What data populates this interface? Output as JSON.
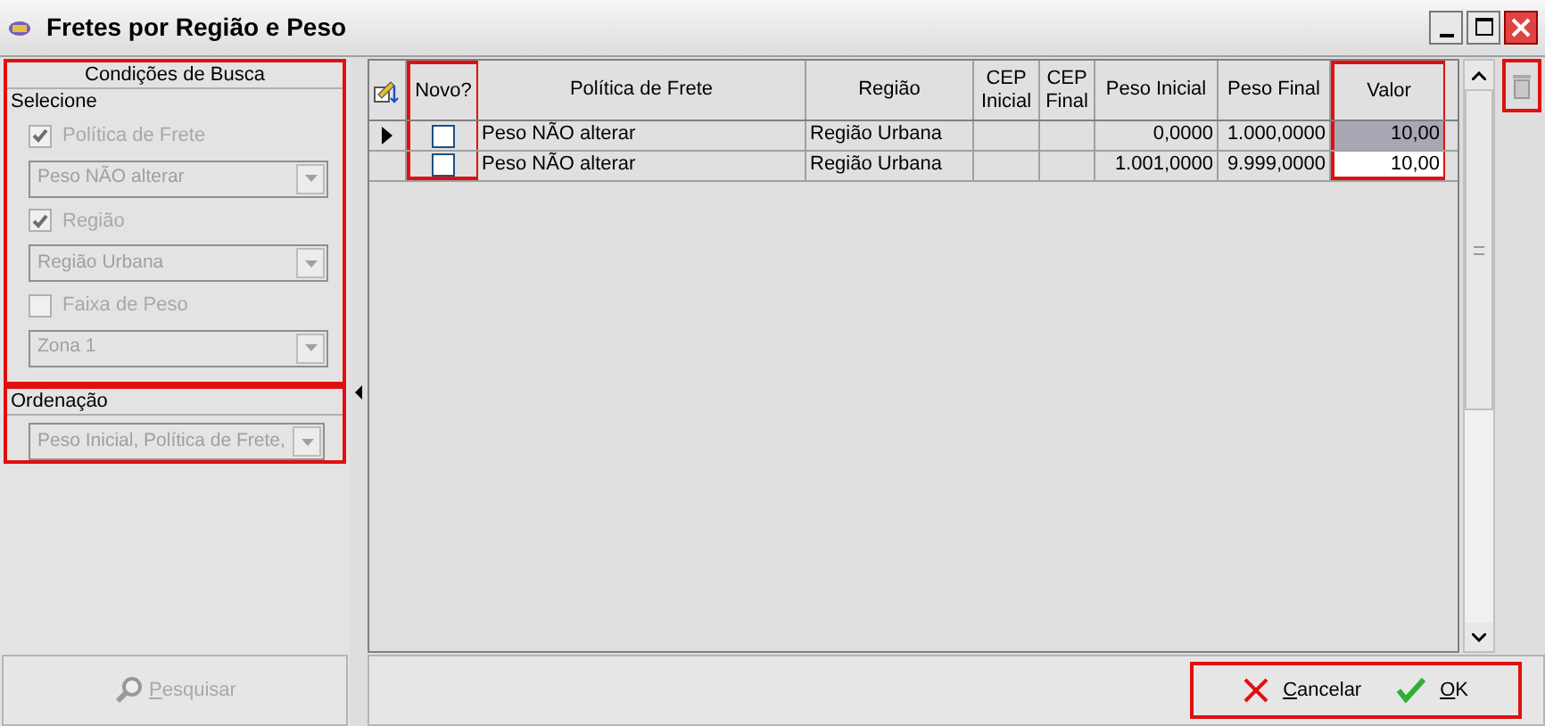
{
  "window": {
    "title": "Fretes por Região e Peso"
  },
  "search_panel": {
    "title": "Condições de Busca",
    "group_label": "Selecione",
    "filters": [
      {
        "label": "Política de Frete",
        "checked": true,
        "disabled": true,
        "value": "Peso NÃO alterar"
      },
      {
        "label": "Região",
        "checked": true,
        "disabled": true,
        "value": "Região Urbana"
      },
      {
        "label": "Faixa de Peso",
        "checked": false,
        "disabled": true,
        "value": "Zona 1"
      }
    ],
    "ordering": {
      "label": "Ordenação",
      "value": "Peso Inicial, Política de Frete,",
      "disabled": true
    },
    "search_button": {
      "label": "Pesquisar",
      "disabled": true
    }
  },
  "table": {
    "checkbox_column": "Novo?",
    "columns": [
      "Política de Frete",
      "Região",
      "CEP Inicial",
      "CEP Final",
      "Peso Inicial",
      "Peso Final",
      "Valor"
    ],
    "rows": [
      {
        "selected": true,
        "novo": false,
        "cells": [
          "Peso NÃO alterar",
          "Região Urbana",
          "",
          "",
          "0,0000",
          "1.000,0000",
          "10,00"
        ]
      },
      {
        "selected": false,
        "novo": false,
        "cells": [
          "Peso NÃO alterar",
          "Região Urbana",
          "",
          "",
          "1.001,0000",
          "9.999,0000",
          "10,00"
        ]
      }
    ]
  },
  "buttons": [
    {
      "kind": "cancel",
      "label": "Cancelar"
    },
    {
      "kind": "ok",
      "label": "OK"
    }
  ]
}
